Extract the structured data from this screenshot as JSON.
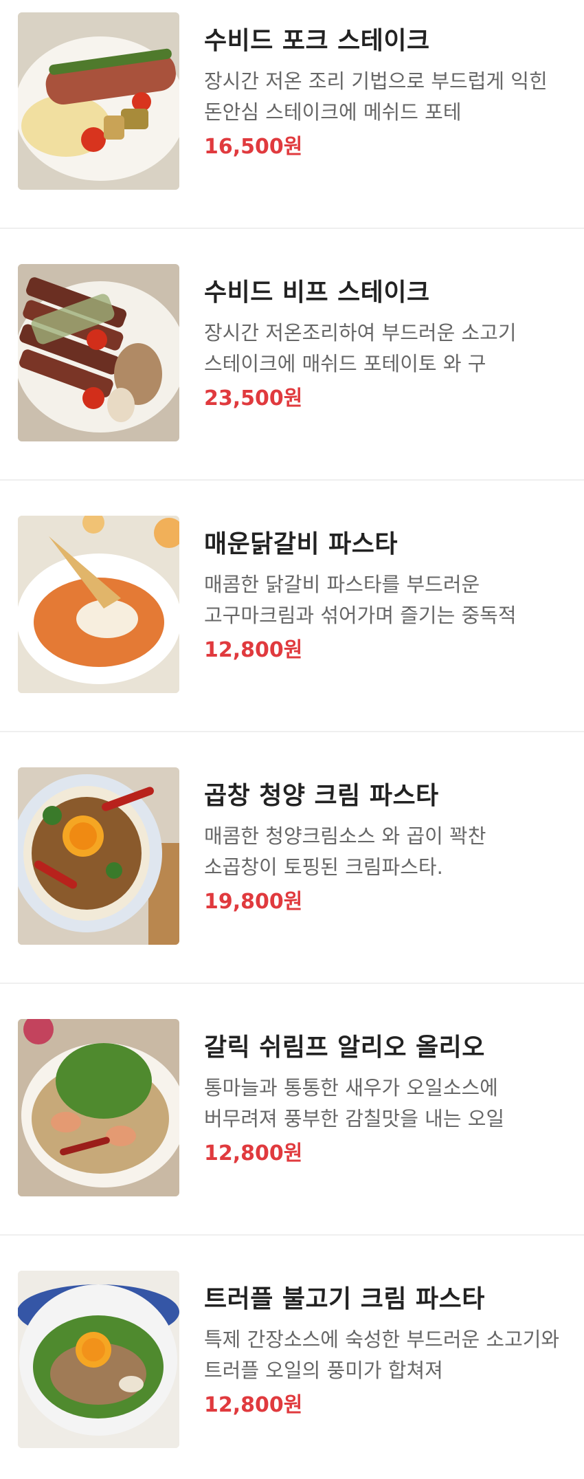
{
  "menu": {
    "items": [
      {
        "name": "수비드 포크 스테이크",
        "description": "장시간 저온 조리 기법으로 부드럽게 익힌 돈안심 스테이크에 메쉬드 포테",
        "price": "16,500원",
        "photo_icon": "pork-steak-photo"
      },
      {
        "name": "수비드 비프 스테이크",
        "description": "장시간 저온조리하여 부드러운 소고기 스테이크에 매쉬드 포테이토 와 구",
        "price": "23,500원",
        "photo_icon": "beef-steak-photo"
      },
      {
        "name": "매운닭갈비 파스타",
        "description": "매콤한 닭갈비 파스타를 부드러운 고구마크림과 섞어가며 즐기는 중독적",
        "price": "12,800원",
        "photo_icon": "spicy-chicken-pasta-photo"
      },
      {
        "name": "곱창 청양 크림 파스타",
        "description": "매콤한 청양크림소스 와 곱이 꽉찬 소곱창이 토핑된 크림파스타.",
        "price": "19,800원",
        "photo_icon": "gopchang-cream-pasta-photo"
      },
      {
        "name": "갈릭 쉬림프 알리오 올리오",
        "description": "통마늘과 통통한 새우가 오일소스에 버무려져 풍부한 감칠맛을 내는 오일",
        "price": "12,800원",
        "photo_icon": "garlic-shrimp-aglio-olio-photo"
      },
      {
        "name": "트러플 불고기 크림 파스타",
        "description": "특제 간장소스에 숙성한 부드러운 소고기와 트러플 오일의 풍미가 합쳐져",
        "price": "12,800원",
        "photo_icon": "truffle-bulgogi-pasta-photo"
      }
    ]
  },
  "colors": {
    "price": "#e03a3e",
    "title": "#222222",
    "description": "#666666",
    "divider": "#efefef"
  }
}
